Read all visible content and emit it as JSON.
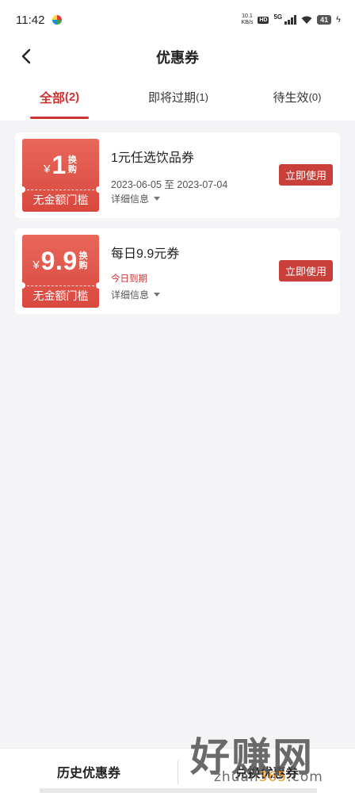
{
  "status_bar": {
    "time": "11:42",
    "net_speed_value": "10.1",
    "net_speed_unit": "KB/s",
    "hd": "HD",
    "network": "5G",
    "battery": "41",
    "charging_icon": "bolt-icon"
  },
  "header": {
    "title": "优惠券",
    "back_icon": "chevron-left-icon"
  },
  "tabs": [
    {
      "label": "全部",
      "count": "(2)",
      "active": true
    },
    {
      "label": "即将过期",
      "count": "(1)",
      "active": false
    },
    {
      "label": "待生效",
      "count": "(0)",
      "active": false
    }
  ],
  "coupons": [
    {
      "currency": "¥",
      "amount": "1",
      "swap_line1": "换",
      "swap_line2": "购",
      "threshold": "无金额门槛",
      "name": "1元任选饮品券",
      "validity": "2023-06-05 至 2023-07-04",
      "detail": "详细信息",
      "action": "立即使用"
    },
    {
      "currency": "¥",
      "amount": "9.9",
      "swap_line1": "换",
      "swap_line2": "购",
      "threshold": "无金额门槛",
      "name": "每日9.9元券",
      "validity": "今日到期",
      "detail": "详细信息",
      "action": "立即使用"
    }
  ],
  "bottom": {
    "history": "历史优惠券",
    "redeem": "兑换优惠券"
  },
  "watermark": {
    "brand": "好赚网",
    "url_prefix": "zhuan",
    "url_highlight": "365",
    "url_suffix": ".com"
  },
  "colors": {
    "accent": "#cc3333",
    "button": "#c9403b",
    "stub_top": "#e8675a",
    "stub_bottom": "#d9483f",
    "background": "#f4f4f6"
  }
}
